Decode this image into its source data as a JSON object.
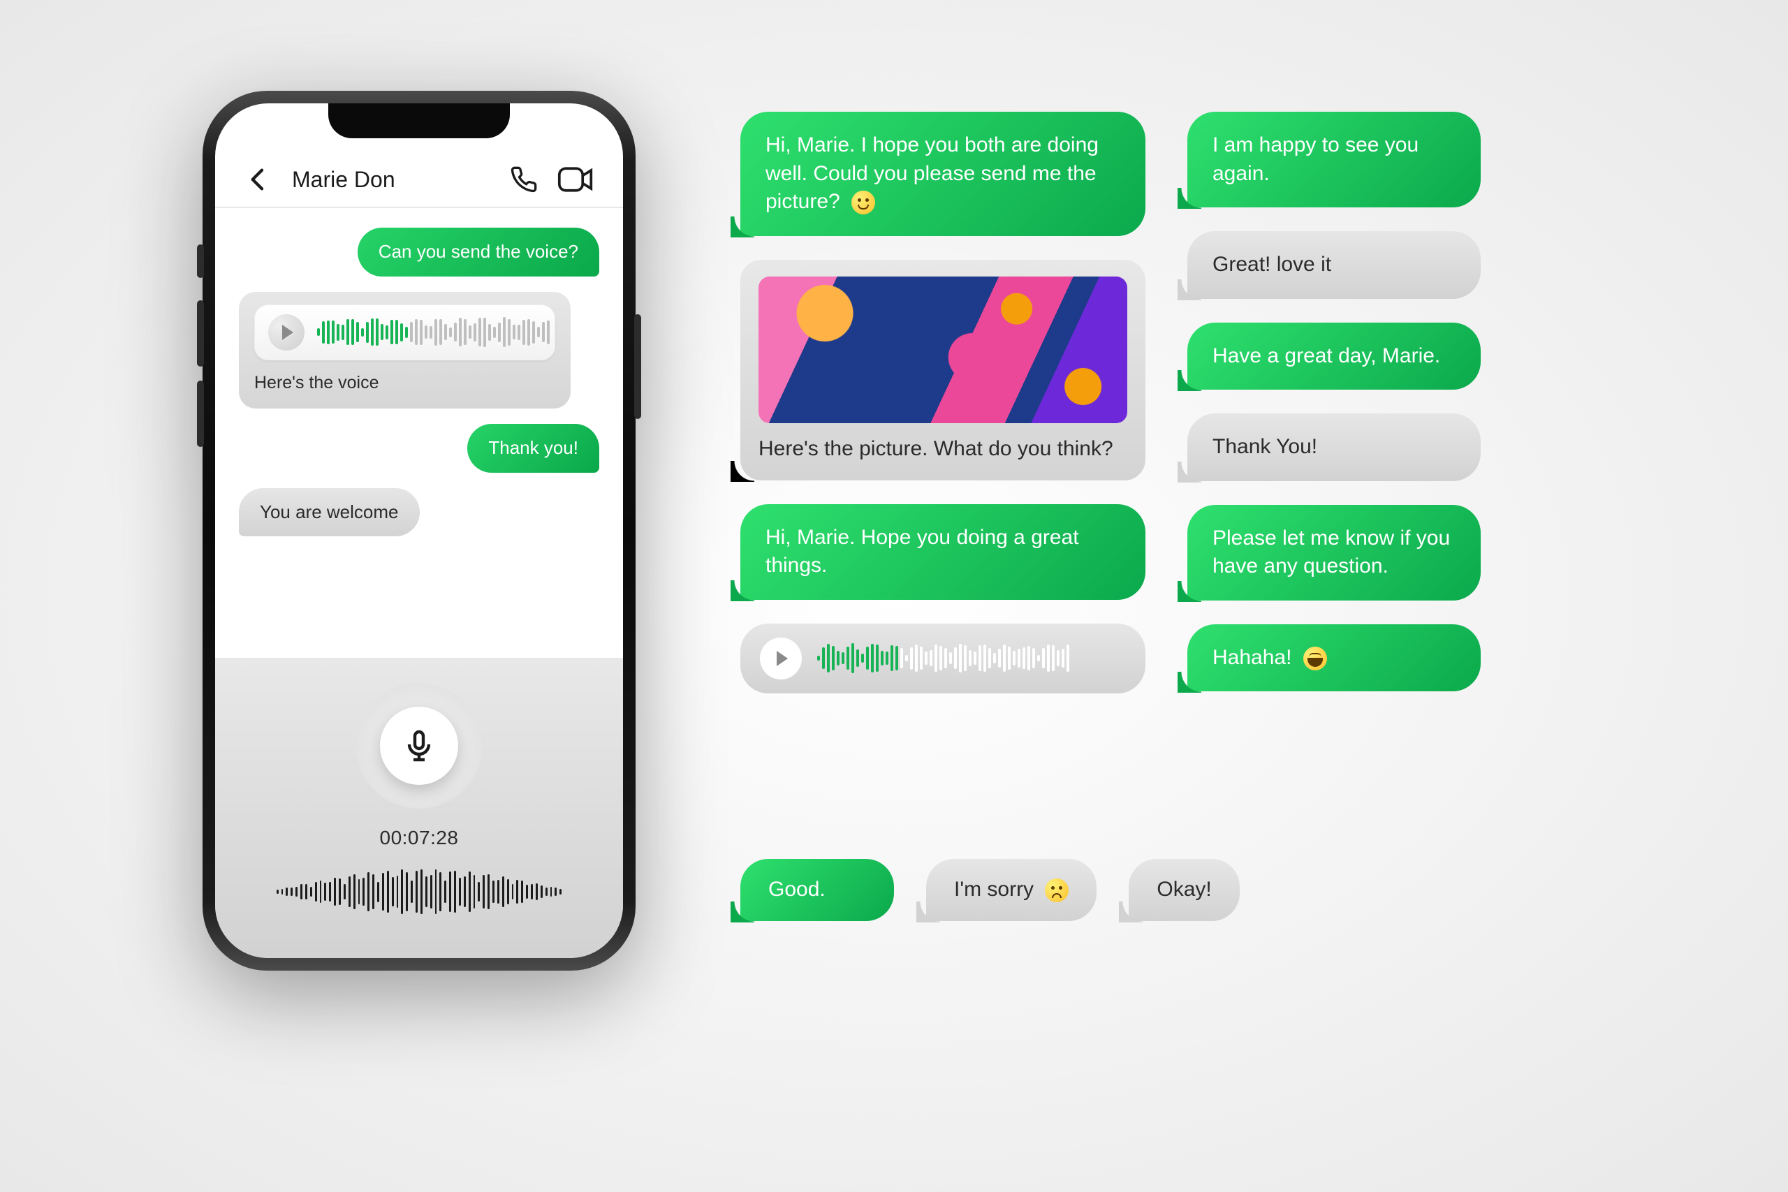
{
  "phone": {
    "contact_name": "Marie Don",
    "messages": {
      "m1": "Can you send the voice?",
      "m2_caption": "Here's the voice",
      "m3": "Thank you!",
      "m4": "You are welcome"
    },
    "recording": {
      "timer": "00:07:28"
    }
  },
  "showcase": {
    "colA": {
      "b1": "Hi, Marie. I hope you both are doing well. Could you please send me the picture?",
      "b2_caption": "Here's the picture. What do you think?",
      "b3": "Hi, Marie. Hope you doing a great things.",
      "b5": "Good."
    },
    "colB": {
      "b1": "I am happy to see you again.",
      "b2": "Great! love it",
      "b3": "Have a great day, Marie.",
      "b4": "Thank You!",
      "b5": "Please let me know if you have any question.",
      "b6": "Hahaha!",
      "b7": "I'm sorry",
      "b8": "Okay!"
    }
  },
  "icons": {
    "back": "back-icon",
    "call": "phone-icon",
    "video": "video-icon",
    "mic": "microphone-icon",
    "play": "play-icon"
  }
}
